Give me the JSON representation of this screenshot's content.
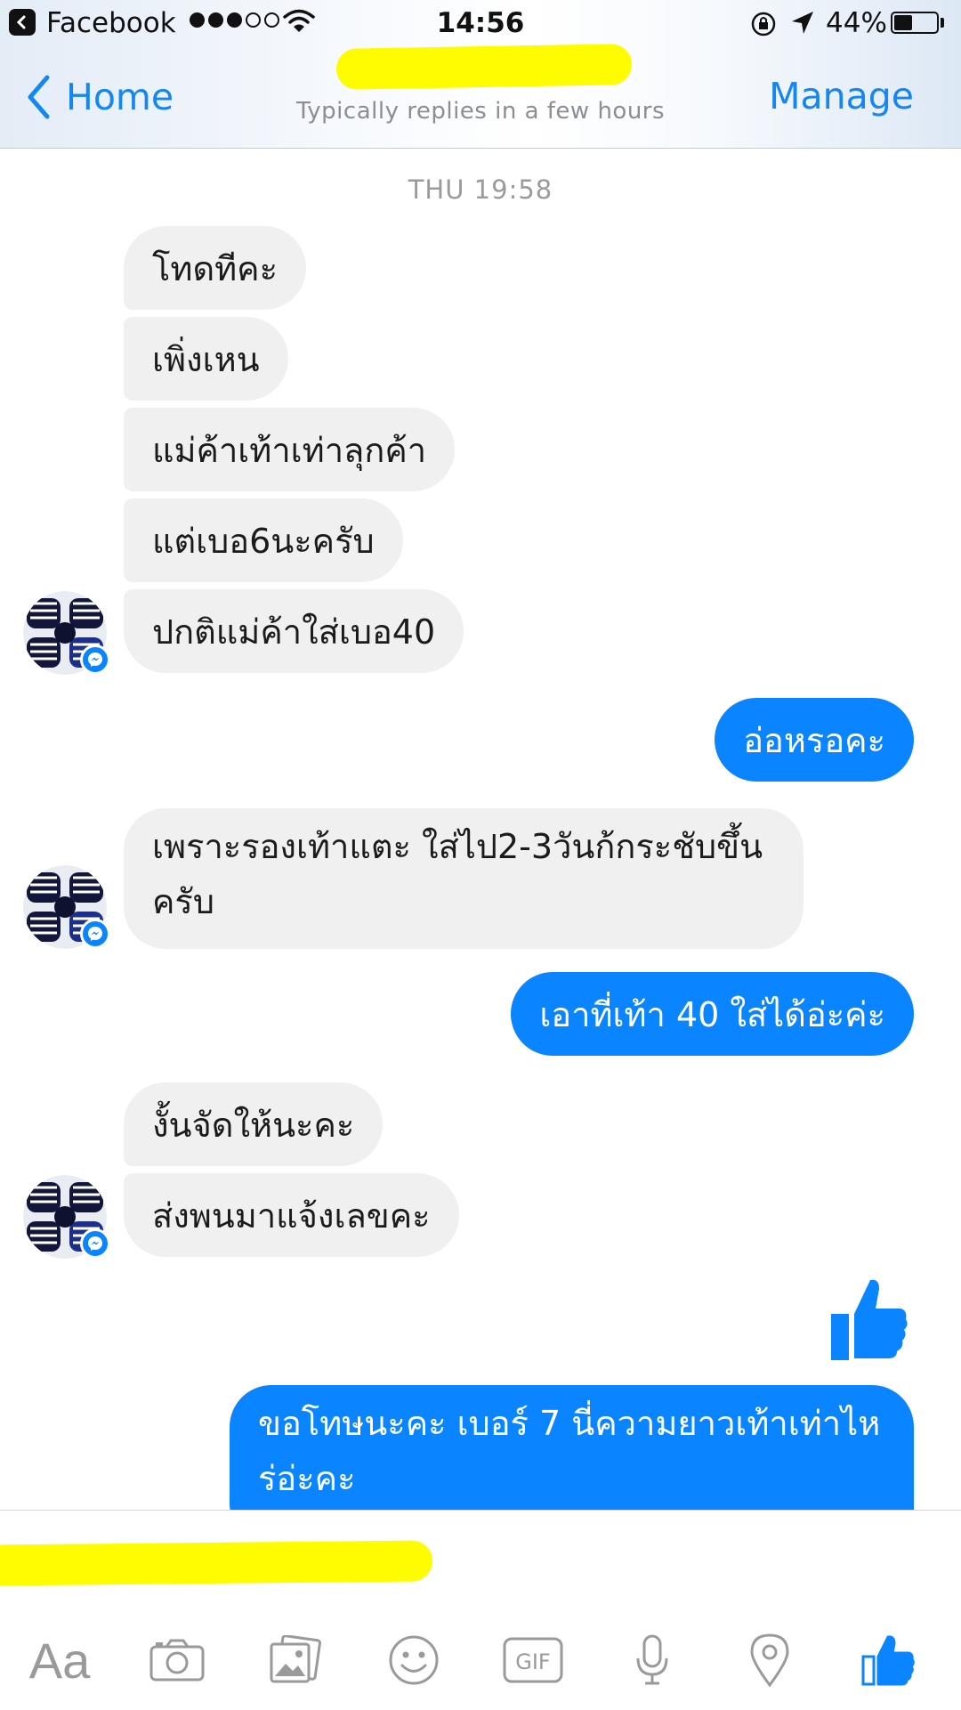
{
  "status_bar": {
    "back_app": "Facebook",
    "time": "14:56",
    "battery_percent_text": "44%",
    "battery_level": 0.44,
    "signal_filled": 3,
    "signal_total": 5
  },
  "nav": {
    "back_label": "Home",
    "subtitle": "Typically replies in a few hours",
    "manage_label": "Manage"
  },
  "conversation": {
    "timestamp": "THU 19:58",
    "messages": [
      {
        "from": "them",
        "text": "โทดทีคะ"
      },
      {
        "from": "them",
        "text": "เพิ่งเหน"
      },
      {
        "from": "them",
        "text": "แม่ค้าเท้าเท่าลุกค้า"
      },
      {
        "from": "them",
        "text": "แต่เบอ6นะครับ"
      },
      {
        "from": "them",
        "text": "ปกติแม่ค้าใส่เบอ40"
      },
      {
        "from": "me",
        "text": "อ่อหรอคะ"
      },
      {
        "from": "them",
        "text": "เพราะรองเท้าแตะ ใส่ไป2-3วันก้กระชับขึ้นครับ"
      },
      {
        "from": "me",
        "text": "เอาที่เท้า 40 ใส่ได้อ่ะค่ะ"
      },
      {
        "from": "them",
        "text": "งั้นจัดให้นะคะ"
      },
      {
        "from": "them",
        "text": "ส่งพนมาแจ้งเลขคะ"
      },
      {
        "from": "me",
        "type": "like"
      },
      {
        "from": "me",
        "text": "ขอโทษนะคะ เบอร์ 7 นี่ความยาวเท้าเท่าไหร่อ่ะคะ"
      }
    ]
  },
  "composer": {
    "placeholder": "",
    "tools": [
      "text-format-icon",
      "camera-icon",
      "photo-icon",
      "emoji-icon",
      "gif-icon",
      "microphone-icon",
      "location-icon",
      "like-icon"
    ],
    "gif_label": "GIF",
    "aa_label": "Aa"
  },
  "colors": {
    "accent": "#0a84ff",
    "link": "#1587f2",
    "incoming_bubble": "#f0f0f0",
    "redaction": "#fffb00"
  }
}
